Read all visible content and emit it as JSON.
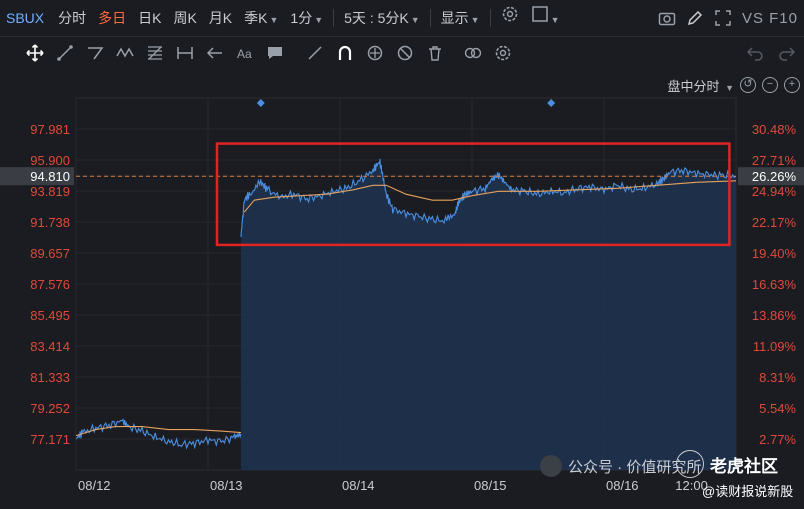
{
  "toolbar": {
    "ticker": "SBUX",
    "timeframes": [
      "分时",
      "多日",
      "日K",
      "周K",
      "月K",
      "季K",
      "1分"
    ],
    "active_timeframe": "多日",
    "period_select": "5天 : 5分K",
    "display_label": "显示",
    "brand": "VS F10"
  },
  "chart_header": {
    "mode_label": "盘中分时"
  },
  "chart_data": {
    "type": "line",
    "title": "",
    "y_price_ticks": [
      "97.981",
      "95.900",
      "94.810",
      "93.819",
      "91.738",
      "89.657",
      "87.576",
      "85.495",
      "83.414",
      "81.333",
      "79.252",
      "77.171"
    ],
    "y_pct_ticks": [
      "30.48%",
      "27.71%",
      "26.26%",
      "24.94%",
      "22.17%",
      "19.40%",
      "16.63%",
      "13.86%",
      "11.09%",
      "8.31%",
      "5.54%",
      "2.77%"
    ],
    "x_ticks": [
      "08/12",
      "08/13",
      "08/14",
      "08/15",
      "08/16",
      "12:00"
    ],
    "current_price": 94.81,
    "current_pct": "26.26%",
    "ylim": [
      75.09,
      100.06
    ],
    "series": [
      {
        "kind": "price",
        "color": "#4a90e2",
        "points": [
          [
            0.0,
            77.2
          ],
          [
            0.01,
            77.6
          ],
          [
            0.03,
            77.9
          ],
          [
            0.05,
            78.1
          ],
          [
            0.07,
            78.4
          ],
          [
            0.08,
            78.0
          ],
          [
            0.1,
            77.7
          ],
          [
            0.12,
            77.3
          ],
          [
            0.14,
            77.0
          ],
          [
            0.16,
            76.8
          ],
          [
            0.18,
            76.9
          ],
          [
            0.2,
            77.1
          ],
          [
            0.22,
            77.0
          ],
          [
            0.24,
            77.3
          ],
          [
            0.25,
            77.5
          ],
          [
            0.25,
            90.8
          ],
          [
            0.255,
            93.2
          ],
          [
            0.265,
            93.7
          ],
          [
            0.28,
            94.4
          ],
          [
            0.29,
            93.9
          ],
          [
            0.31,
            93.4
          ],
          [
            0.33,
            93.6
          ],
          [
            0.35,
            93.3
          ],
          [
            0.37,
            93.5
          ],
          [
            0.39,
            93.8
          ],
          [
            0.41,
            94.0
          ],
          [
            0.43,
            94.5
          ],
          [
            0.45,
            95.2
          ],
          [
            0.46,
            95.8
          ],
          [
            0.465,
            94.8
          ],
          [
            0.47,
            93.6
          ],
          [
            0.48,
            92.6
          ],
          [
            0.5,
            92.3
          ],
          [
            0.52,
            92.1
          ],
          [
            0.54,
            91.9
          ],
          [
            0.56,
            91.8
          ],
          [
            0.575,
            92.4
          ],
          [
            0.58,
            93.1
          ],
          [
            0.59,
            93.6
          ],
          [
            0.6,
            93.8
          ],
          [
            0.62,
            94.0
          ],
          [
            0.63,
            94.6
          ],
          [
            0.64,
            94.9
          ],
          [
            0.65,
            94.4
          ],
          [
            0.66,
            93.9
          ],
          [
            0.68,
            93.8
          ],
          [
            0.7,
            93.6
          ],
          [
            0.72,
            93.8
          ],
          [
            0.74,
            93.7
          ],
          [
            0.76,
            94.0
          ],
          [
            0.78,
            94.1
          ],
          [
            0.8,
            93.9
          ],
          [
            0.82,
            94.2
          ],
          [
            0.84,
            93.9
          ],
          [
            0.86,
            94.0
          ],
          [
            0.88,
            94.3
          ],
          [
            0.89,
            94.6
          ],
          [
            0.9,
            95.1
          ],
          [
            0.92,
            95.2
          ],
          [
            0.94,
            95.0
          ],
          [
            0.96,
            94.9
          ],
          [
            0.98,
            94.85
          ],
          [
            1.0,
            94.81
          ]
        ]
      },
      {
        "kind": "average",
        "color": "#e6a15c",
        "points": [
          [
            0.0,
            77.4
          ],
          [
            0.03,
            77.8
          ],
          [
            0.06,
            78.0
          ],
          [
            0.1,
            78.0
          ],
          [
            0.14,
            77.8
          ],
          [
            0.18,
            77.8
          ],
          [
            0.22,
            77.7
          ],
          [
            0.25,
            77.6
          ],
          [
            0.255,
            92.4
          ],
          [
            0.27,
            93.2
          ],
          [
            0.3,
            93.4
          ],
          [
            0.34,
            93.5
          ],
          [
            0.38,
            93.6
          ],
          [
            0.42,
            93.9
          ],
          [
            0.45,
            94.2
          ],
          [
            0.47,
            94.2
          ],
          [
            0.5,
            93.6
          ],
          [
            0.54,
            93.2
          ],
          [
            0.57,
            93.2
          ],
          [
            0.6,
            93.5
          ],
          [
            0.64,
            93.8
          ],
          [
            0.7,
            93.8
          ],
          [
            0.76,
            93.9
          ],
          [
            0.82,
            94.0
          ],
          [
            0.88,
            94.2
          ],
          [
            0.94,
            94.4
          ],
          [
            1.0,
            94.5
          ]
        ]
      }
    ],
    "markers": [
      {
        "label": "08/13 marker",
        "x": 0.28
      },
      {
        "label": "08/15 marker",
        "x": 0.72
      }
    ],
    "highlight_box": {
      "x_from": 0.25,
      "x_to": 0.99,
      "y_from": 90.2,
      "y_to": 97.0
    }
  },
  "watermark": {
    "line1": "公众号 · 价值研究所",
    "brand": "老虎社区",
    "brand_sub": "@读财报说新股"
  }
}
